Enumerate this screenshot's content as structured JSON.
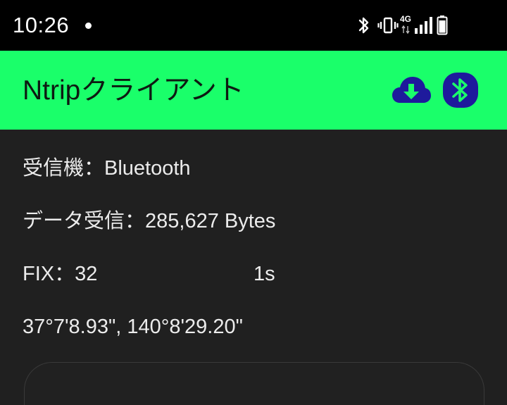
{
  "status_bar": {
    "time": "10:26",
    "network_label": "4G",
    "icons": [
      "notification-dot-icon",
      "bluetooth-icon",
      "vibrate-icon",
      "signal-icon",
      "battery-icon"
    ]
  },
  "app_bar": {
    "title": "Ntripクライアント",
    "background_color": "#1aff6a",
    "actions": [
      {
        "name": "cloud-download-icon",
        "color": "#1e1a9c"
      },
      {
        "name": "bluetooth-icon",
        "color": "#1e1a9c"
      }
    ]
  },
  "info": {
    "receiver_label": "受信機：",
    "receiver_value": "Bluetooth",
    "data_label": "データ受信：",
    "data_value": "285,627 Bytes",
    "fix_label": "FIX：",
    "fix_value": "32",
    "fix_age": "1s",
    "coordinates": "37°7'8.93\", 140°8'29.20\""
  }
}
